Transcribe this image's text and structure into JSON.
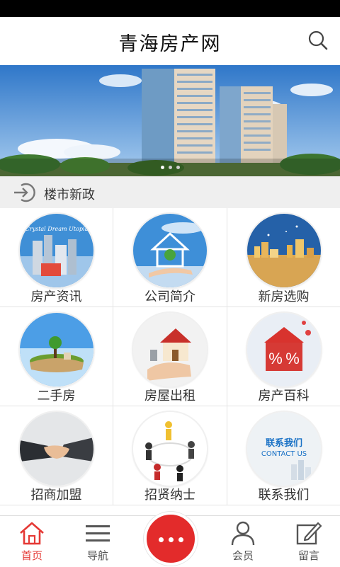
{
  "header": {
    "title": "青海房产网"
  },
  "notice": {
    "text": "楼市新政"
  },
  "grid": [
    {
      "label": "房产资讯"
    },
    {
      "label": "公司简介"
    },
    {
      "label": "新房选购"
    },
    {
      "label": "二手房"
    },
    {
      "label": "房屋出租"
    },
    {
      "label": "房产百科"
    },
    {
      "label": "招商加盟"
    },
    {
      "label": "招贤纳士"
    },
    {
      "label": "联系我们"
    }
  ],
  "thumbs": {
    "dream": "Crystal Dream Utopia",
    "contact_cn": "联系我们",
    "contact_en": "CONTACT US",
    "percent": "%"
  },
  "tabbar": [
    {
      "label": "首页",
      "icon": "home-icon"
    },
    {
      "label": "导航",
      "icon": "menu-icon"
    },
    {
      "label": "会员",
      "icon": "user-icon"
    },
    {
      "label": "留言",
      "icon": "edit-icon"
    }
  ],
  "colors": {
    "accent": "#e32b2b",
    "text": "#333333"
  }
}
